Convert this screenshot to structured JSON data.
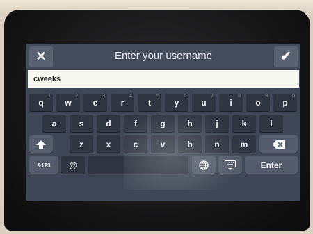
{
  "header": {
    "title": "Enter your username",
    "close_glyph": "✕",
    "confirm_glyph": "✔"
  },
  "input": {
    "value": "cweeks"
  },
  "keyboard": {
    "row1": [
      {
        "label": "q",
        "alt": "1"
      },
      {
        "label": "w",
        "alt": "2"
      },
      {
        "label": "e",
        "alt": "3"
      },
      {
        "label": "r",
        "alt": "4"
      },
      {
        "label": "t",
        "alt": "5"
      },
      {
        "label": "y",
        "alt": "6"
      },
      {
        "label": "u",
        "alt": "7"
      },
      {
        "label": "i",
        "alt": "8"
      },
      {
        "label": "o",
        "alt": "9"
      },
      {
        "label": "p",
        "alt": "0"
      }
    ],
    "row2": [
      "a",
      "s",
      "d",
      "f",
      "g",
      "h",
      "j",
      "k",
      "l"
    ],
    "row3": [
      "z",
      "x",
      "c",
      "v",
      "b",
      "n",
      "m"
    ],
    "mode_label": "&123",
    "at_label": "@",
    "enter_label": "Enter",
    "icons": {
      "shift": "shift-arrow-icon",
      "backspace": "backspace-icon",
      "globe": "globe-icon",
      "hide": "keyboard-hide-icon"
    }
  },
  "colors": {
    "screen_bg": "#3f4756",
    "key_bg": "#2f3541",
    "func_key_bg": "#545c6b",
    "input_bg": "#f7f7f2"
  }
}
